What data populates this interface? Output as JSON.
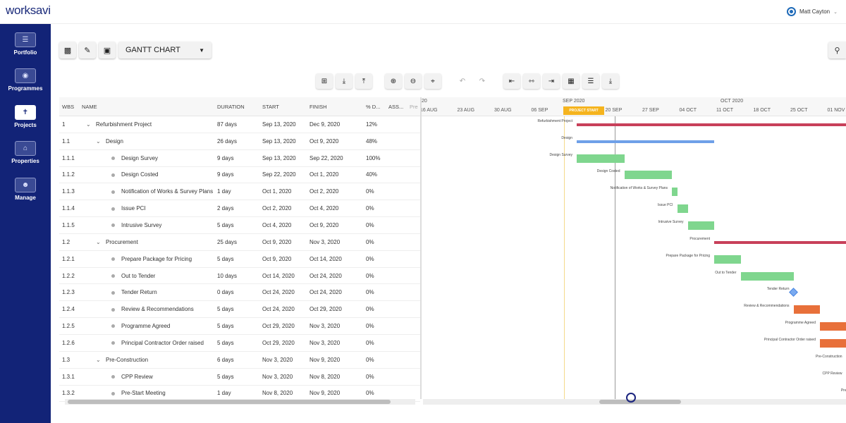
{
  "app": {
    "logo_text": "worksavi",
    "user_name": "Matt Cayton"
  },
  "sidebar": {
    "items": [
      {
        "label": "Portfolio",
        "icon": "portfolio-icon"
      },
      {
        "label": "Programmes",
        "icon": "programmes-icon"
      },
      {
        "label": "Projects",
        "icon": "projects-icon",
        "active": true
      },
      {
        "label": "Properties",
        "icon": "properties-icon"
      },
      {
        "label": "Manage",
        "icon": "manage-icon"
      }
    ]
  },
  "toolbar": {
    "view_select": "GANTT CHART"
  },
  "table": {
    "headers": {
      "wbs": "WBS",
      "name": "NAME",
      "duration": "DURATION",
      "start": "START",
      "finish": "FINISH",
      "pct": "% D...",
      "assigned": "ASS...",
      "pred": "Pre"
    },
    "rows": [
      {
        "wbs": "1",
        "name": "Refurbishment Project",
        "duration": "87 days",
        "start": "Sep 13, 2020",
        "finish": "Dec 9, 2020",
        "pct": "12%",
        "level": 0,
        "kind": "summary"
      },
      {
        "wbs": "1.1",
        "name": "Design",
        "duration": "26 days",
        "start": "Sep 13, 2020",
        "finish": "Oct 9, 2020",
        "pct": "48%",
        "level": 1,
        "kind": "summary"
      },
      {
        "wbs": "1.1.1",
        "name": "Design Survey",
        "duration": "9 days",
        "start": "Sep 13, 2020",
        "finish": "Sep 22, 2020",
        "pct": "100%",
        "level": 2,
        "kind": "task"
      },
      {
        "wbs": "1.1.2",
        "name": "Design Costed",
        "duration": "9 days",
        "start": "Sep 22, 2020",
        "finish": "Oct 1, 2020",
        "pct": "40%",
        "level": 2,
        "kind": "task"
      },
      {
        "wbs": "1.1.3",
        "name": "Notification of Works & Survey Plans",
        "duration": "1 day",
        "start": "Oct 1, 2020",
        "finish": "Oct 2, 2020",
        "pct": "0%",
        "level": 2,
        "kind": "task"
      },
      {
        "wbs": "1.1.4",
        "name": "Issue PCI",
        "duration": "2 days",
        "start": "Oct 2, 2020",
        "finish": "Oct 4, 2020",
        "pct": "0%",
        "level": 2,
        "kind": "task"
      },
      {
        "wbs": "1.1.5",
        "name": "Intrusive Survey",
        "duration": "5 days",
        "start": "Oct 4, 2020",
        "finish": "Oct 9, 2020",
        "pct": "0%",
        "level": 2,
        "kind": "task"
      },
      {
        "wbs": "1.2",
        "name": "Procurement",
        "duration": "25 days",
        "start": "Oct 9, 2020",
        "finish": "Nov 3, 2020",
        "pct": "0%",
        "level": 1,
        "kind": "summary"
      },
      {
        "wbs": "1.2.1",
        "name": "Prepare Package for Pricing",
        "duration": "5 days",
        "start": "Oct 9, 2020",
        "finish": "Oct 14, 2020",
        "pct": "0%",
        "level": 2,
        "kind": "task"
      },
      {
        "wbs": "1.2.2",
        "name": "Out to Tender",
        "duration": "10 days",
        "start": "Oct 14, 2020",
        "finish": "Oct 24, 2020",
        "pct": "0%",
        "level": 2,
        "kind": "task"
      },
      {
        "wbs": "1.2.3",
        "name": "Tender Return",
        "duration": "0 days",
        "start": "Oct 24, 2020",
        "finish": "Oct 24, 2020",
        "pct": "0%",
        "level": 2,
        "kind": "milestone"
      },
      {
        "wbs": "1.2.4",
        "name": "Review & Recommendations",
        "duration": "5 days",
        "start": "Oct 24, 2020",
        "finish": "Oct 29, 2020",
        "pct": "0%",
        "level": 2,
        "kind": "task"
      },
      {
        "wbs": "1.2.5",
        "name": "Programme Agreed",
        "duration": "5 days",
        "start": "Oct 29, 2020",
        "finish": "Nov 3, 2020",
        "pct": "0%",
        "level": 2,
        "kind": "task"
      },
      {
        "wbs": "1.2.6",
        "name": "Principal Contractor Order raised",
        "duration": "5 days",
        "start": "Oct 29, 2020",
        "finish": "Nov 3, 2020",
        "pct": "0%",
        "level": 2,
        "kind": "task"
      },
      {
        "wbs": "1.3",
        "name": "Pre-Construction",
        "duration": "6 days",
        "start": "Nov 3, 2020",
        "finish": "Nov 9, 2020",
        "pct": "0%",
        "level": 1,
        "kind": "summary"
      },
      {
        "wbs": "1.3.1",
        "name": "CPP Review",
        "duration": "5 days",
        "start": "Nov 3, 2020",
        "finish": "Nov 8, 2020",
        "pct": "0%",
        "level": 2,
        "kind": "task"
      },
      {
        "wbs": "1.3.2",
        "name": "Pre-Start Meeting",
        "duration": "1 day",
        "start": "Nov 8, 2020",
        "finish": "Nov 9, 2020",
        "pct": "0%",
        "level": 2,
        "kind": "task"
      }
    ]
  },
  "gantt": {
    "header_partial": "20",
    "months": [
      {
        "label": "SEP 2020"
      },
      {
        "label": "OCT 2020"
      }
    ],
    "ticks": [
      "16 AUG",
      "23 AUG",
      "30 AUG",
      "06 SEP",
      "13 SEP",
      "20 SEP",
      "27 SEP",
      "04 OCT",
      "11 OCT",
      "18 OCT",
      "25 OCT",
      "01 NOV"
    ],
    "project_start_label": "PROJECT START",
    "bar_labels": [
      "Refurbishment Project",
      "Design",
      "Design Survey",
      "Design Costed",
      "Notification of Works & Survey Plans",
      "Issue PCI",
      "Intrusive Survey",
      "Procurement",
      "Prepare Package for Pricing",
      "Out to Tender",
      "Tender Return",
      "Review & Recommendations",
      "Programme Agreed",
      "Principal Contractor Order raised",
      "Pre-Construction",
      "CPP Review",
      "Pre-Start Meeting"
    ],
    "colors": {
      "summary_red": "#c8405a",
      "summary_blue": "#6fa0e8",
      "task_green": "#7fd68e",
      "task_orange": "#e8703a",
      "milestone": "#7aaaf0",
      "project_start": "#f5b41e"
    }
  }
}
